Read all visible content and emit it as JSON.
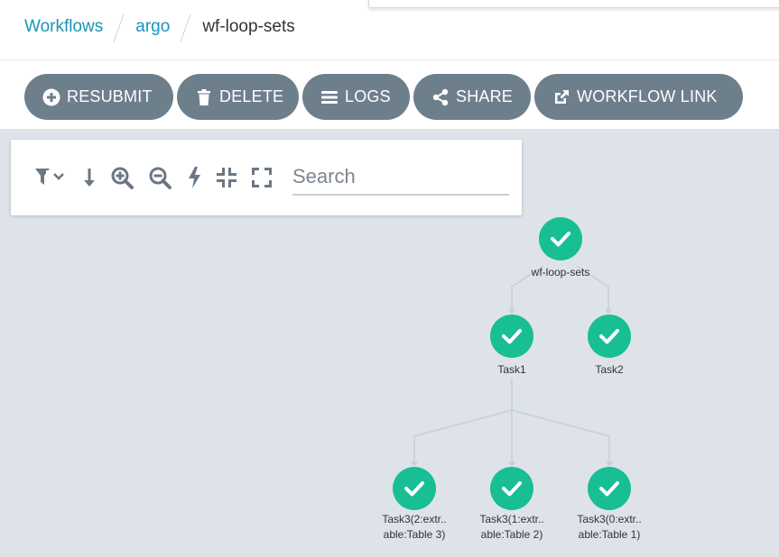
{
  "breadcrumbs": {
    "workflows": "Workflows",
    "namespace": "argo",
    "current": "wf-loop-sets"
  },
  "toolbar": {
    "resubmit": "RESUBMIT",
    "delete": "DELETE",
    "logs": "LOGS",
    "share": "SHARE",
    "workflow_link": "WORKFLOW LINK"
  },
  "graph_tools": {
    "search_placeholder": "Search"
  },
  "nodes": {
    "root": {
      "label": "wf-loop-sets",
      "status": "succeeded"
    },
    "task1": {
      "label": "Task1",
      "status": "succeeded"
    },
    "task2": {
      "label": "Task2",
      "status": "succeeded"
    },
    "task3_2": {
      "label_line1": "Task3(2:extr..",
      "label_line2": "able:Table 3)",
      "status": "succeeded"
    },
    "task3_1": {
      "label_line1": "Task3(1:extr..",
      "label_line2": "able:Table 2)",
      "status": "succeeded"
    },
    "task3_0": {
      "label_line1": "Task3(0:extr..",
      "label_line2": "able:Table 1)",
      "status": "succeeded"
    }
  },
  "colors": {
    "link": "#1a94b8",
    "button": "#6e7f8c",
    "canvas": "#dee3e9",
    "success": "#18be94"
  }
}
